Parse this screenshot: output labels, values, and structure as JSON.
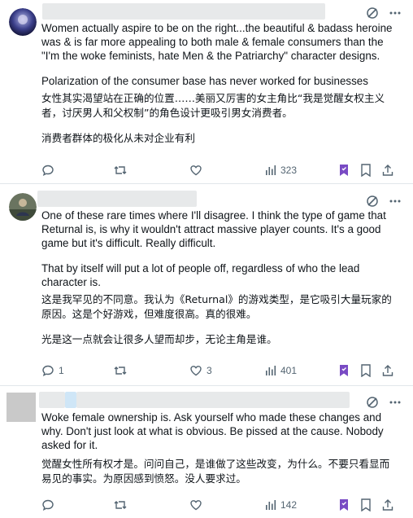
{
  "posts": [
    {
      "paragraphs": [
        "Women actually aspire to be on the right...the beautiful & badass heroine was & is far more appealing to both male & female consumers than the \"I'm the woke feminists, hate Men & the Patriarchy\" character designs.",
        "Polarization of the consumer base has never worked for businesses"
      ],
      "translation": [
        "女性其实渴望站在正确的位置……美丽又厉害的女主角比“我是觉醒女权主义者，讨厌男人和父权制”的角色设计更吸引男女消费者。",
        "消费者群体的极化从未对企业有利"
      ],
      "actions": {
        "replies": "",
        "reposts": "",
        "likes": "",
        "views": "323"
      }
    },
    {
      "paragraphs": [
        "One of these rare times where I'll disagree. I think the type of game that Returnal is, is why it wouldn't attract massive player counts. It's a good game but it's difficult. Really difficult.",
        "That by itself will put a lot of people off, regardless of who the lead character is."
      ],
      "translation": [
        "这是我罕见的不同意。我认为《Returnal》的游戏类型，是它吸引大量玩家的原因。这是个好游戏，但难度很高。真的很难。",
        "光是这一点就会让很多人望而却步，无论主角是谁。"
      ],
      "actions": {
        "replies": "1",
        "reposts": "",
        "likes": "3",
        "views": "401"
      }
    },
    {
      "paragraphs": [
        "Woke female ownership is. Ask yourself who made these changes and why. Don't just look at what is obvious. Be pissed at the cause. Nobody asked for it."
      ],
      "translation": [
        "觉醒女性所有权才是。问问自己，是谁做了这些改变，为什么。不要只看显而易见的事实。为原因感到愤怒。没人要求过。"
      ],
      "actions": {
        "replies": "",
        "reposts": "",
        "likes": "",
        "views": "142"
      }
    }
  ],
  "icons": [
    "grok-icon",
    "more-icon",
    "reply-icon",
    "repost-icon",
    "like-icon",
    "views-icon",
    "bookmark-icon",
    "share-icon"
  ],
  "colors": {
    "text": "#0f1419",
    "muted": "#536471",
    "divider": "#e1e6ea",
    "bookmark": "#794bc4",
    "redacted": "#e7e9ea"
  }
}
